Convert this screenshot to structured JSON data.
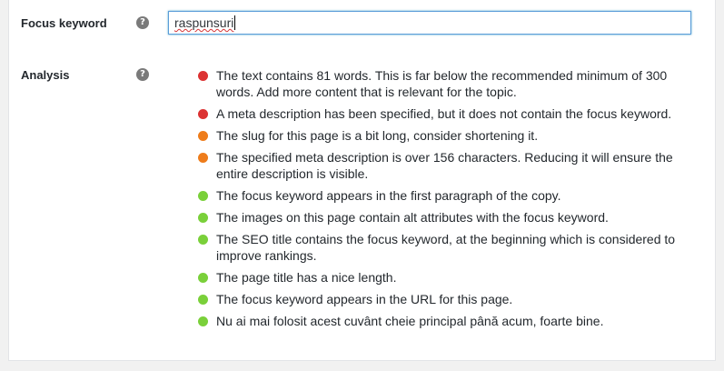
{
  "focus_keyword": {
    "label": "Focus keyword",
    "help": "?",
    "value": "raspunsuri"
  },
  "analysis": {
    "label": "Analysis",
    "help": "?",
    "items": [
      {
        "status": "bad",
        "color": "#dc3232",
        "text": "The text contains 81 words. This is far below the recommended minimum of 300 words. Add more content that is relevant for the topic."
      },
      {
        "status": "bad",
        "color": "#dc3232",
        "text": "A meta description has been specified, but it does not contain the focus keyword."
      },
      {
        "status": "ok",
        "color": "#ee7c1b",
        "text": "The slug for this page is a bit long, consider shortening it."
      },
      {
        "status": "ok",
        "color": "#ee7c1b",
        "text": "The specified meta description is over 156 characters. Reducing it will ensure the entire description is visible."
      },
      {
        "status": "good",
        "color": "#7ad03a",
        "text": "The focus keyword appears in the first paragraph of the copy."
      },
      {
        "status": "good",
        "color": "#7ad03a",
        "text": "The images on this page contain alt attributes with the focus keyword."
      },
      {
        "status": "good",
        "color": "#7ad03a",
        "text": "The SEO title contains the focus keyword, at the beginning which is considered to improve rankings."
      },
      {
        "status": "good",
        "color": "#7ad03a",
        "text": "The page title has a nice length."
      },
      {
        "status": "good",
        "color": "#7ad03a",
        "text": "The focus keyword appears in the URL for this page."
      },
      {
        "status": "good",
        "color": "#7ad03a",
        "text": "Nu ai mai folosit acest cuvânt cheie principal până acum, foarte bine."
      }
    ]
  }
}
